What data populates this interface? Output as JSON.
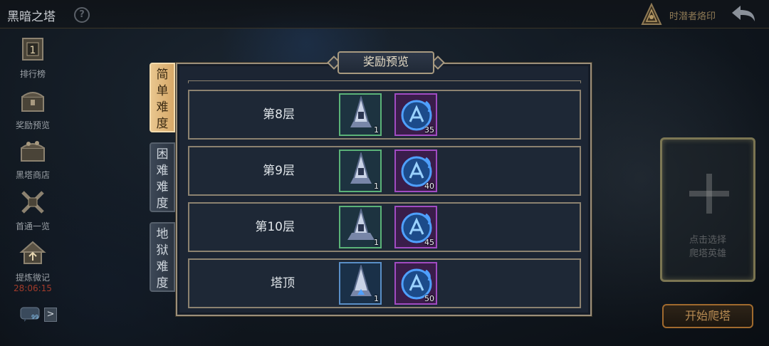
{
  "header": {
    "title": "黑暗之塔",
    "emblem_label": "时潜者烙印"
  },
  "sidebar": {
    "items": [
      {
        "label": "排行榜",
        "icon": "rank-icon"
      },
      {
        "label": "奖励预览",
        "icon": "chest-icon"
      },
      {
        "label": "黑塔商店",
        "icon": "shop-chest-icon"
      },
      {
        "label": "首通一览",
        "icon": "swords-icon"
      },
      {
        "label": "提炼微记",
        "icon": "house-icon",
        "timer": "28:06:15"
      }
    ],
    "chat_count": "99"
  },
  "tabs": [
    {
      "chars": [
        "简",
        "单",
        "难",
        "度"
      ],
      "active": true
    },
    {
      "chars": [
        "困",
        "难",
        "难",
        "度"
      ],
      "active": false
    },
    {
      "chars": [
        "地",
        "狱",
        "难",
        "度"
      ],
      "active": false
    }
  ],
  "panel": {
    "title": "奖励预览",
    "rows": [
      {
        "label": "第8层",
        "items": [
          {
            "icon": "tower-token-icon",
            "qty": "1",
            "rarity": "green"
          },
          {
            "icon": "blue-rune-icon",
            "qty": "35",
            "rarity": "purple"
          }
        ]
      },
      {
        "label": "第9层",
        "items": [
          {
            "icon": "tower-token-icon",
            "qty": "1",
            "rarity": "green"
          },
          {
            "icon": "blue-rune-icon",
            "qty": "40",
            "rarity": "purple"
          }
        ]
      },
      {
        "label": "第10层",
        "items": [
          {
            "icon": "tower-token-icon",
            "qty": "1",
            "rarity": "green"
          },
          {
            "icon": "blue-rune-icon",
            "qty": "45",
            "rarity": "purple"
          }
        ]
      },
      {
        "label": "塔顶",
        "items": [
          {
            "icon": "tower-token-icon",
            "qty": "1",
            "rarity": "blue"
          },
          {
            "icon": "blue-rune-icon",
            "qty": "50",
            "rarity": "purple"
          }
        ]
      }
    ]
  },
  "hero_slot": {
    "hint_line1": "点击选择",
    "hint_line2": "爬塔英雄"
  },
  "start_button": "开始爬塔",
  "colors": {
    "accent_gold": "#d6a868",
    "panel_border": "#9c8f7a",
    "rarity_green": "#5bb378",
    "rarity_blue": "#5a8fc7",
    "rarity_purple": "#a14bc2",
    "timer_red": "#a13b2a"
  }
}
